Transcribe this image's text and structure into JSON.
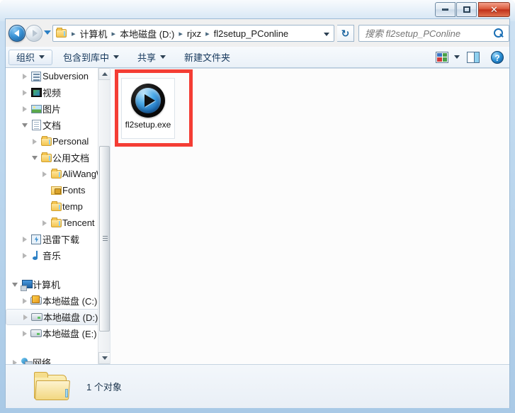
{
  "window": {
    "caption_buttons": {
      "minimize": "minimize-button",
      "maximize": "maximize-button",
      "close_label": "✕"
    }
  },
  "navigation": {
    "back_tooltip": "后退",
    "forward_tooltip": "前进",
    "recent_pages": "recent-pages-dropdown",
    "refresh_label": "↻",
    "breadcrumb": [
      "计算机",
      "本地磁盘 (D:)",
      "rjxz",
      "fl2setup_PConline"
    ],
    "separator": "▸"
  },
  "search": {
    "placeholder": "搜索 fl2setup_PConline",
    "value": ""
  },
  "toolbar": {
    "items": [
      {
        "label": "组织",
        "caret": true,
        "active": true
      },
      {
        "label": "包含到库中",
        "caret": true,
        "active": false
      },
      {
        "label": "共享",
        "caret": true,
        "active": false
      },
      {
        "label": "新建文件夹",
        "caret": false,
        "active": false
      }
    ],
    "views_label": "更改您的视图",
    "preview_label": "显示预览窗格",
    "help_label": "?"
  },
  "sidebar": {
    "items": [
      {
        "label": "Subversion",
        "indent": 1,
        "twisty": "closed",
        "icon": "svn-icon",
        "selected": false
      },
      {
        "label": "视频",
        "indent": 1,
        "twisty": "closed",
        "icon": "video-icon",
        "selected": false
      },
      {
        "label": "图片",
        "indent": 1,
        "twisty": "closed",
        "icon": "picture-icon",
        "selected": false
      },
      {
        "label": "文档",
        "indent": 1,
        "twisty": "open",
        "icon": "document-icon",
        "selected": false
      },
      {
        "label": "Personal",
        "indent": 2,
        "twisty": "closed",
        "icon": "folder-icon",
        "selected": false
      },
      {
        "label": "公用文档",
        "indent": 2,
        "twisty": "open",
        "icon": "folder-icon",
        "selected": false
      },
      {
        "label": "AliWangWan",
        "indent": 3,
        "twisty": "closed",
        "icon": "folder-icon",
        "selected": false
      },
      {
        "label": "Fonts",
        "indent": 3,
        "twisty": "none",
        "icon": "folder-lock-icon",
        "selected": false
      },
      {
        "label": "temp",
        "indent": 3,
        "twisty": "none",
        "icon": "folder-icon",
        "selected": false
      },
      {
        "label": "Tencent",
        "indent": 3,
        "twisty": "closed",
        "icon": "folder-icon",
        "selected": false
      },
      {
        "label": "迅雷下载",
        "indent": 1,
        "twisty": "closed",
        "icon": "thunder-icon",
        "selected": false
      },
      {
        "label": "音乐",
        "indent": 1,
        "twisty": "closed",
        "icon": "music-icon",
        "selected": false
      },
      {
        "label": "",
        "indent": 0,
        "twisty": "none",
        "icon": "spacer",
        "selected": false
      },
      {
        "label": "计算机",
        "indent": 0,
        "twisty": "open",
        "icon": "computer-icon",
        "selected": false
      },
      {
        "label": "本地磁盘 (C:)",
        "indent": 1,
        "twisty": "closed",
        "icon": "drive-win-icon",
        "selected": false
      },
      {
        "label": "本地磁盘 (D:)",
        "indent": 1,
        "twisty": "closed",
        "icon": "drive-icon",
        "selected": true
      },
      {
        "label": "本地磁盘 (E:)",
        "indent": 1,
        "twisty": "closed",
        "icon": "drive-icon",
        "selected": false
      },
      {
        "label": "",
        "indent": 0,
        "twisty": "none",
        "icon": "spacer",
        "selected": false
      },
      {
        "label": "网络",
        "indent": 0,
        "twisty": "closed",
        "icon": "network-icon",
        "selected": false
      }
    ]
  },
  "content": {
    "files": [
      {
        "name": "fl2setup.exe",
        "icon": "media-player-exe-icon",
        "selected": true,
        "highlighted": true
      }
    ],
    "highlight_color": "#f43d34"
  },
  "status": {
    "text": "1 个对象",
    "folder_icon": "folder-icon"
  }
}
